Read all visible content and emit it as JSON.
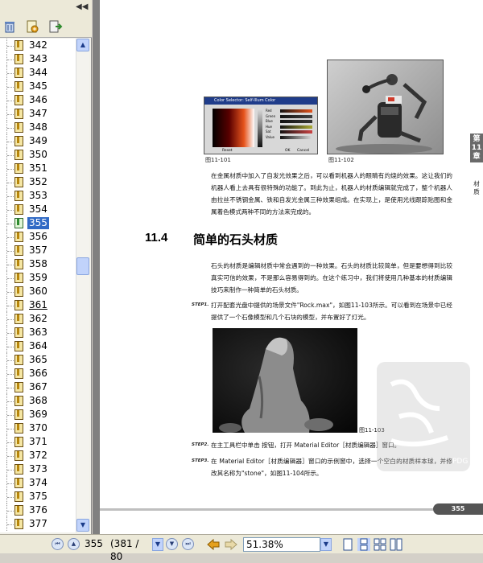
{
  "sidebar": {
    "collapse_glyph": "◀◀",
    "toolbar_icons": [
      "trash-icon",
      "new-bookmark-icon",
      "goto-bookmark-icon"
    ],
    "items": [
      "342",
      "343",
      "344",
      "345",
      "346",
      "347",
      "348",
      "349",
      "350",
      "351",
      "352",
      "353",
      "354",
      "355",
      "356",
      "357",
      "358",
      "359",
      "360",
      "361",
      "362",
      "363",
      "364",
      "365",
      "366",
      "367",
      "368",
      "369",
      "370",
      "371",
      "372",
      "373",
      "374",
      "375",
      "376",
      "377"
    ],
    "selected": "355",
    "underlined": "361"
  },
  "document": {
    "fig1_caption": "图11-101",
    "fig2_caption": "图11-102",
    "fig3_caption": "图11-103",
    "dialog_title": "Color Selector: Self-Illum Color",
    "dialog_labels": [
      "Red",
      "Green",
      "Blue",
      "Hue",
      "Sat",
      "Value"
    ],
    "dialog_buttons": [
      "Reset",
      "OK",
      "Cancel"
    ],
    "para1": "在金属材质中加入了自发光效果之后，可以看到机器人的眼睛有灼烧的效果。这让我们的机器人看上去具有很特殊的功能了。到此为止，机器人的材质编辑就完成了，整个机器人由拉丝不锈钢金属、铁和自发光金属三种效果组成。在实现上，是使用光线跟踪贴图和金属着色模式两种不同的方法来完成的。",
    "section_number": "11.4",
    "section_title": "简单的石头材质",
    "para2": "石头的材质是编辑材质中常会遇到的一种效果。石头的材质比较简单，但是要想得到比较真实可信的效果，不是那么容易得到的。在这个练习中，我们将使用几种基本的材质编辑技巧来制作一种简单的石头材质。",
    "step1_label": "STEP1.",
    "step1_text": "打开配套光盘中提供的场景文件\"Rock.max\"，如图11-103所示。可以看到在场景中已经提供了一个石像模型和几个石块的模型，并布置好了灯光。",
    "step2_label": "STEP2.",
    "step2_text": "在主工具栏中单击 按钮，打开 Material Editor［材质编辑器］窗口。",
    "step3_label": "STEP3.",
    "step3_text": "在 Material Editor［材质编辑器］窗口的示例窗中，选择一个空白的材质样本球，并修改其名称为\"stone\"，如图11-104所示。",
    "chapter_tab": "第11章",
    "chapter_side": "材质",
    "page_number": "355",
    "watermark_text": "PDG"
  },
  "statusbar": {
    "current_page": "355",
    "page_of": "(381 / 80",
    "zoom": "51.38%"
  }
}
